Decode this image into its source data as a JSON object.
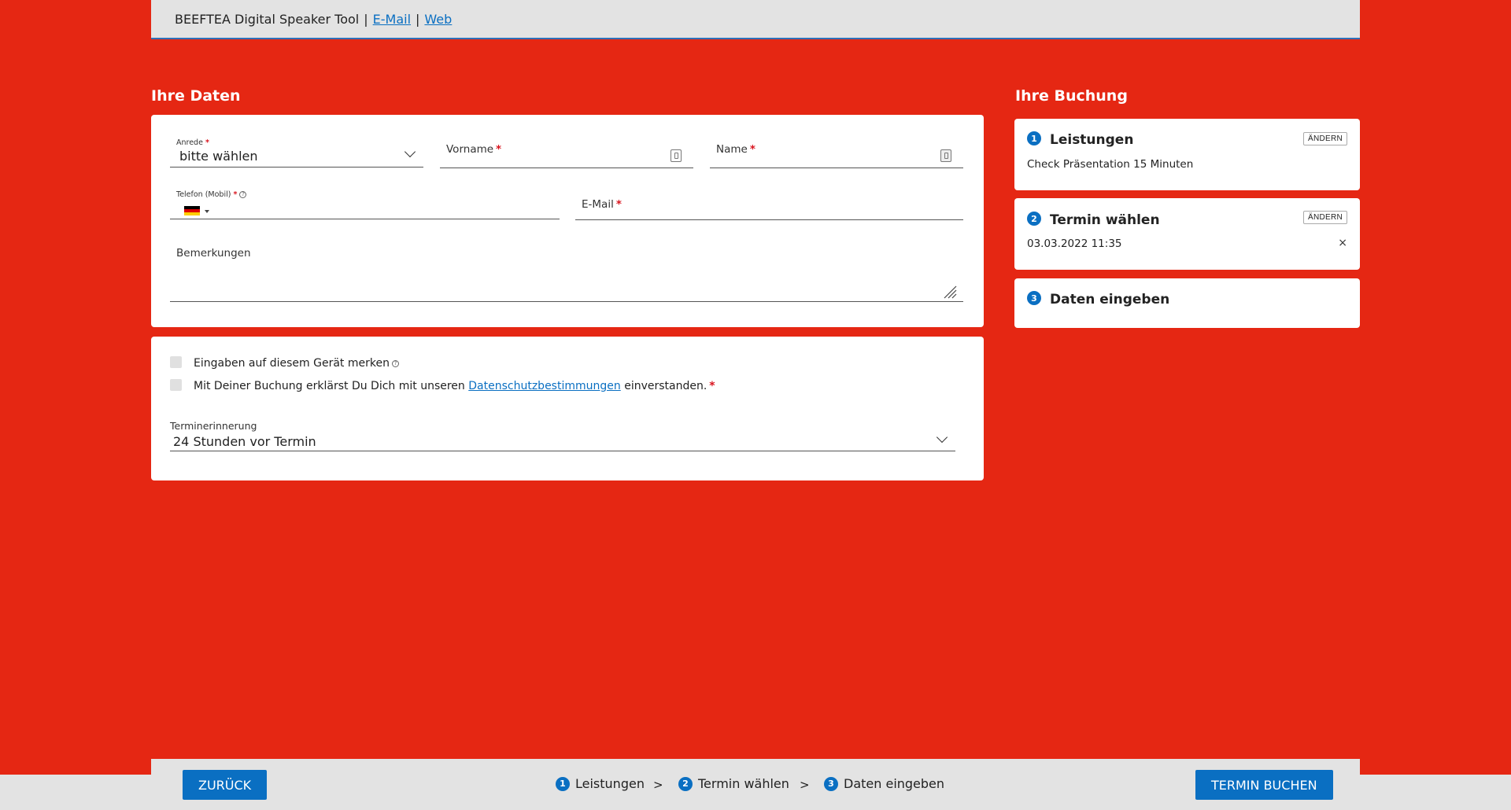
{
  "header": {
    "title": "BEEFTEA Digital Speaker Tool",
    "separator": "|",
    "email_link": "E-Mail",
    "web_link": "Web"
  },
  "form_section": {
    "title": "Ihre Daten",
    "anrede": {
      "label": "Anrede",
      "value": "bitte wählen",
      "required": "*"
    },
    "vorname": {
      "label": "Vorname",
      "required": "*"
    },
    "name": {
      "label": "Name",
      "required": "*"
    },
    "telefon": {
      "label": "Telefon (Mobil)",
      "required": "*"
    },
    "email": {
      "label": "E-Mail",
      "required": "*"
    },
    "bemerkungen": {
      "label": "Bemerkungen"
    }
  },
  "options_section": {
    "remember_label": "Eingaben auf diesem Gerät merken",
    "privacy_prefix": "Mit Deiner Buchung erklärst Du Dich mit unseren",
    "privacy_link": "Datenschutzbestimmungen",
    "privacy_suffix": "einverstanden.",
    "required": "*",
    "reminder": {
      "label": "Terminerinnerung",
      "value": "24 Stunden vor Termin"
    }
  },
  "booking_section": {
    "title": "Ihre Buchung",
    "steps": [
      {
        "num": "1",
        "title": "Leistungen",
        "change": "ÄNDERN",
        "detail": "Check Präsentation 15 Minuten"
      },
      {
        "num": "2",
        "title": "Termin wählen",
        "change": "ÄNDERN",
        "detail": "03.03.2022 11:35",
        "remove": "×"
      },
      {
        "num": "3",
        "title": "Daten eingeben"
      }
    ]
  },
  "footer": {
    "back_label": "ZURÜCK",
    "book_label": "TERMIN BUCHEN",
    "separator": ">",
    "breadcrumb": [
      {
        "num": "1",
        "label": "Leistungen"
      },
      {
        "num": "2",
        "label": "Termin wählen"
      },
      {
        "num": "3",
        "label": "Daten eingeben"
      }
    ]
  },
  "colors": {
    "background": "#e52713",
    "accent": "#0a6fc2",
    "required": "#d9141e",
    "bar": "#e3e3e3"
  },
  "flag": {
    "country": "de",
    "colors": [
      "#000000",
      "#dd0000",
      "#ffce00"
    ]
  }
}
